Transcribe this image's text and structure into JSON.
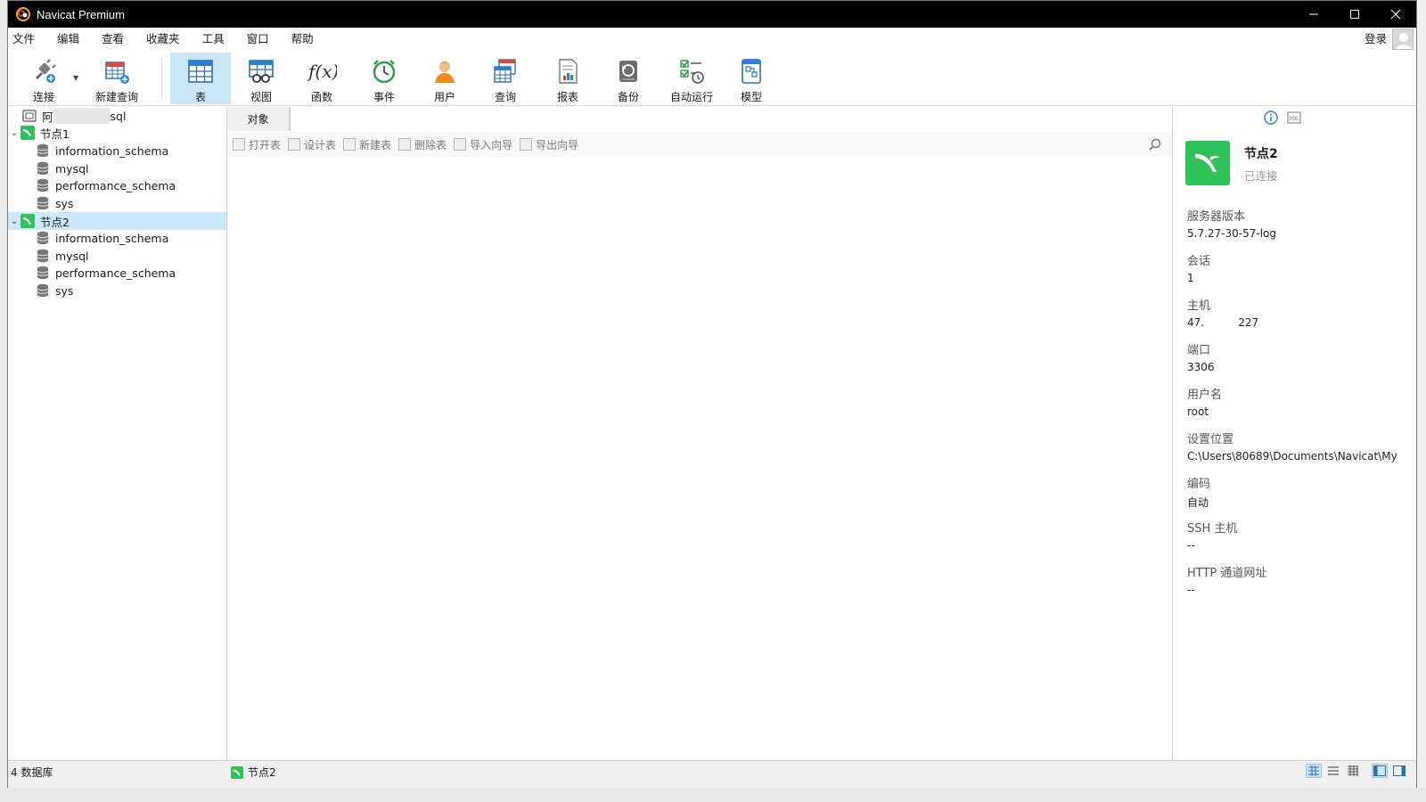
{
  "window": {
    "title": "Navicat Premium"
  },
  "menu": [
    "文件",
    "编辑",
    "查看",
    "收藏夹",
    "工具",
    "窗口",
    "帮助"
  ],
  "account": {
    "login": "登录"
  },
  "toolbar": {
    "connect": "连接",
    "new_query": "新建查询",
    "table": "表",
    "view": "视图",
    "function": "函数",
    "event": "事件",
    "user": "用户",
    "query": "查询",
    "report": "报表",
    "backup": "备份",
    "automation": "自动运行",
    "model": "模型"
  },
  "tree": {
    "conn0_suffix": "sql",
    "conn0_prefix": "阿",
    "conn1": {
      "name": "节点1",
      "dbs": [
        "information_schema",
        "mysql",
        "performance_schema",
        "sys"
      ]
    },
    "conn2": {
      "name": "节点2",
      "dbs": [
        "information_schema",
        "mysql",
        "performance_schema",
        "sys"
      ]
    }
  },
  "tabs": {
    "objects": "对象"
  },
  "object_toolbar": {
    "open_table": "打开表",
    "design_table": "设计表",
    "new_table": "新建表",
    "delete_table": "删除表",
    "import_wizard": "导入向导",
    "export_wizard": "导出向导"
  },
  "info": {
    "name": "节点2",
    "status": "已连接",
    "fields": [
      {
        "label": "服务器版本",
        "value": "5.7.27-30-57-log"
      },
      {
        "label": "会话",
        "value": "1"
      },
      {
        "label": "主机",
        "value": "47.          227"
      },
      {
        "label": "端口",
        "value": "3306"
      },
      {
        "label": "用户名",
        "value": "root"
      },
      {
        "label": "设置位置",
        "value": "C:\\Users\\80689\\Documents\\Navicat\\My"
      },
      {
        "label": "编码",
        "value": "自动"
      },
      {
        "label": "SSH 主机",
        "value": "--"
      },
      {
        "label": "HTTP 通道网址",
        "value": "--"
      }
    ]
  },
  "status": {
    "db_count": "4 数据库",
    "current": "节点2"
  },
  "colors": {
    "accent": "#cde6f7",
    "mysql_green": "#2fc25b",
    "selected": "#cce8ff"
  }
}
